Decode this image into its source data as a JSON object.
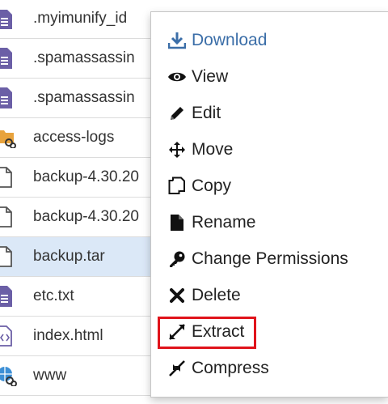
{
  "files": [
    {
      "name": ".myimunify_id",
      "icon": "text-file-icon",
      "selected": false
    },
    {
      "name": ".spamassassin",
      "icon": "text-file-icon",
      "selected": false
    },
    {
      "name": ".spamassassin",
      "icon": "text-file-icon",
      "selected": false
    },
    {
      "name": "access-logs",
      "icon": "folder-link-icon",
      "selected": false
    },
    {
      "name": "backup-4.30.20",
      "icon": "blank-file-icon",
      "selected": false
    },
    {
      "name": "backup-4.30.20",
      "icon": "blank-file-icon",
      "selected": false
    },
    {
      "name": "backup.tar",
      "icon": "blank-file-icon",
      "selected": true
    },
    {
      "name": "etc.txt",
      "icon": "text-file-icon",
      "selected": false
    },
    {
      "name": "index.html",
      "icon": "html-file-icon",
      "selected": false
    },
    {
      "name": "www",
      "icon": "globe-link-icon",
      "selected": false
    }
  ],
  "context_menu": {
    "items": [
      {
        "label": "Download",
        "icon": "download-icon"
      },
      {
        "label": "View",
        "icon": "eye-icon"
      },
      {
        "label": "Edit",
        "icon": "pencil-icon"
      },
      {
        "label": "Move",
        "icon": "move-arrows-icon"
      },
      {
        "label": "Copy",
        "icon": "copy-icon"
      },
      {
        "label": "Rename",
        "icon": "file-icon"
      },
      {
        "label": "Change Permissions",
        "icon": "key-icon"
      },
      {
        "label": "Delete",
        "icon": "x-icon"
      },
      {
        "label": "Extract",
        "icon": "expand-icon"
      },
      {
        "label": "Compress",
        "icon": "compress-icon"
      }
    ],
    "highlighted": "Extract"
  },
  "colors": {
    "download_text": "#3b6ea8",
    "highlight_border": "#e0131b",
    "selected_row": "#dbe8f7",
    "file_icon": "#6b5fa6",
    "folder_icon": "#e8a33d"
  }
}
